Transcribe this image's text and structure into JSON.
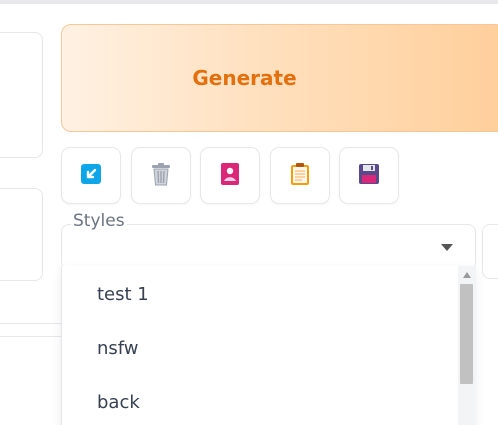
{
  "generate": {
    "label": "Generate"
  },
  "toolbar": {
    "buttons": [
      {
        "name": "paste-arrow-button",
        "icon": "arrow-down-left-icon",
        "color": "#0ea5e9"
      },
      {
        "name": "trash-button",
        "icon": "trash-icon",
        "color": "#9ca3af"
      },
      {
        "name": "image-button",
        "icon": "image-card-icon",
        "color": "#db2777"
      },
      {
        "name": "clipboard-button",
        "icon": "clipboard-icon",
        "color": "#f59e0b"
      },
      {
        "name": "save-button",
        "icon": "floppy-disk-icon",
        "color": "#5b4a8a"
      }
    ]
  },
  "styles": {
    "label": "Styles",
    "selected": "",
    "options": [
      "test 1",
      "nsfw",
      "back"
    ]
  },
  "colors": {
    "accent": "#e3700d",
    "generate_gradient_start": "#fff1e3",
    "generate_gradient_end": "#ffcf9b"
  }
}
